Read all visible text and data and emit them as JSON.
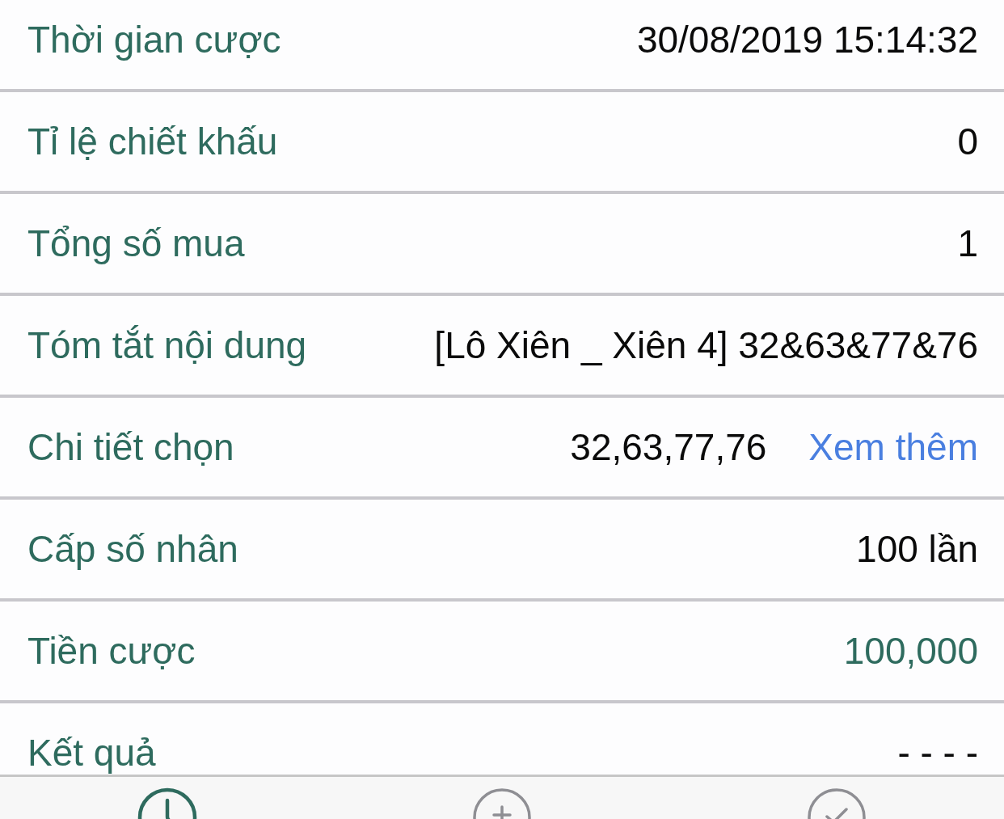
{
  "rows": [
    {
      "kind": "plain",
      "label": "Thời gian cược",
      "value": "30/08/2019 15:14:32"
    },
    {
      "kind": "plain",
      "label": "Tỉ lệ chiết khấu",
      "value": "0"
    },
    {
      "kind": "plain",
      "label": "Tổng số mua",
      "value": "1"
    },
    {
      "kind": "plain",
      "label": "Tóm tắt nội dung",
      "value": "[Lô Xiên _ Xiên 4] 32&63&77&76"
    },
    {
      "kind": "link",
      "label": "Chi tiết chọn",
      "value": "32,63,77,76",
      "link": "Xem thêm"
    },
    {
      "kind": "plain",
      "label": "Cấp số nhân",
      "value": "100 lần"
    },
    {
      "kind": "amount",
      "label": "Tiền cược",
      "value": "100,000"
    },
    {
      "kind": "plain",
      "label": "Kết quả",
      "value": "- - - -"
    }
  ],
  "tabs": [
    {
      "selected": true
    },
    {
      "selected": false
    },
    {
      "selected": false
    }
  ]
}
